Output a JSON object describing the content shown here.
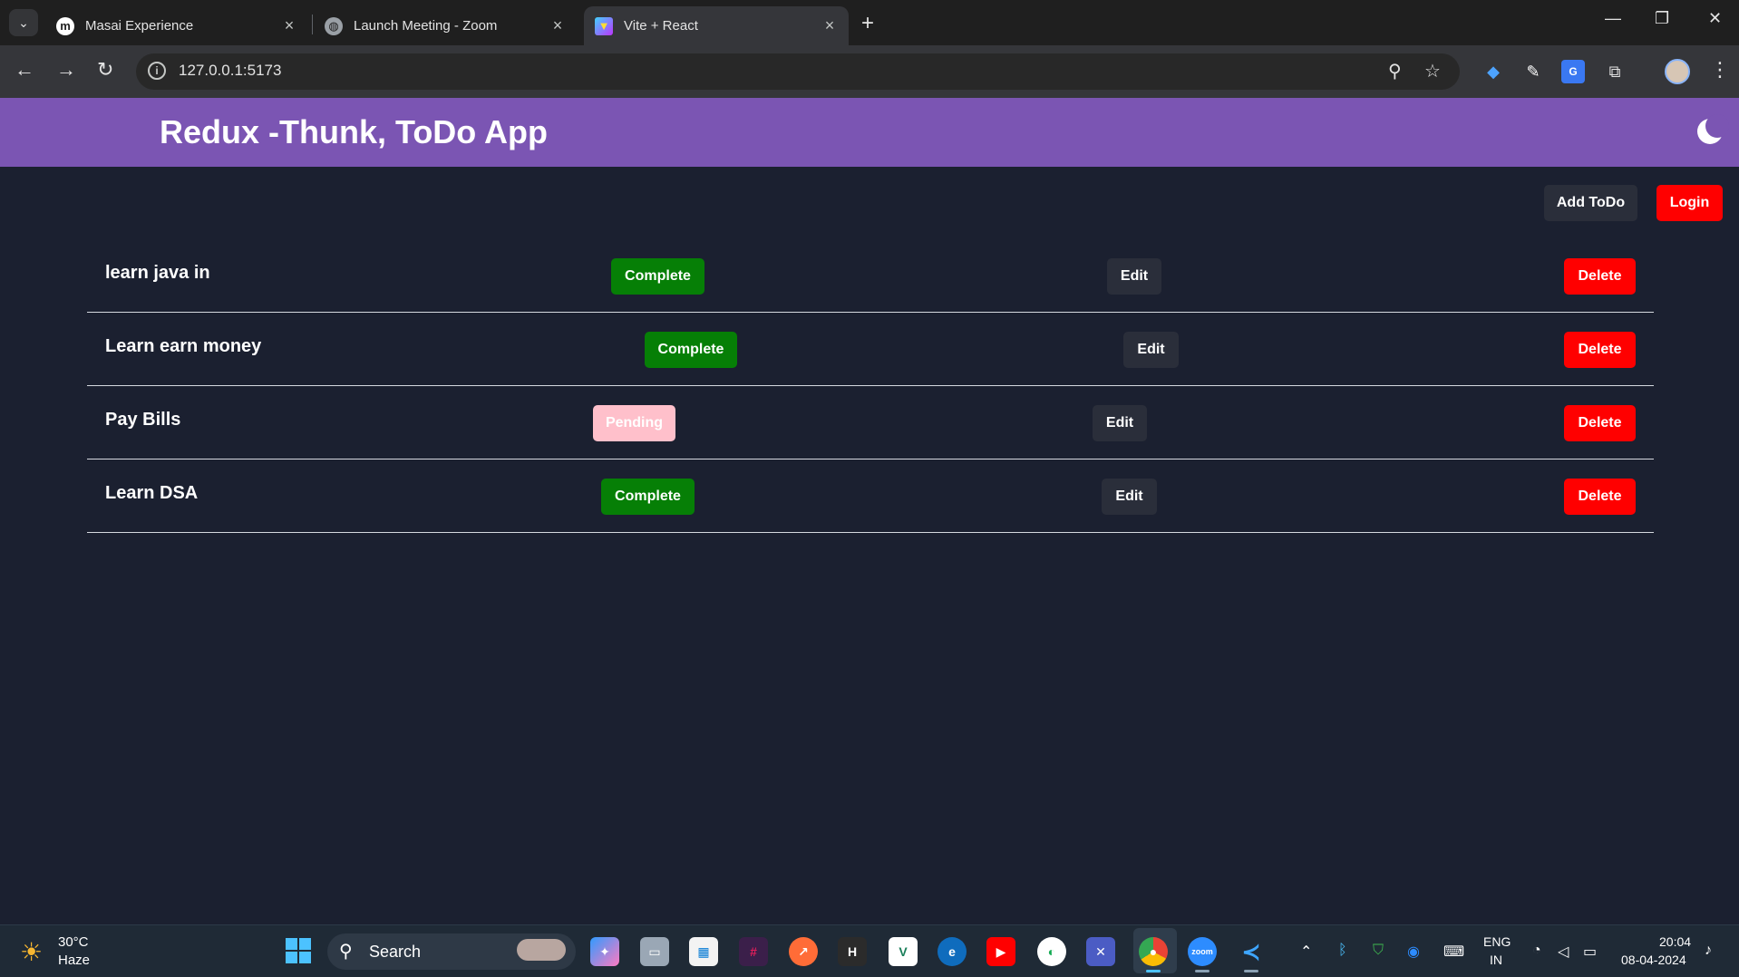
{
  "browser": {
    "tabs": [
      {
        "title": "Masai Experience",
        "favicon": "masai-logo"
      },
      {
        "title": "Launch Meeting - Zoom",
        "favicon": "globe-icon"
      },
      {
        "title": "Vite + React",
        "favicon": "vite-logo"
      }
    ],
    "url": "127.0.0.1:5173"
  },
  "app": {
    "title": "Redux -Thunk, ToDo App",
    "add_todo_label": "Add ToDo",
    "login_label": "Login",
    "colors": {
      "header": "#7b55b3",
      "background": "#1b2030",
      "complete": "#067f06",
      "pending": "#ffc0cb",
      "delete": "#ff0000"
    }
  },
  "todos": [
    {
      "title": "learn java in",
      "status": "Complete",
      "edit_label": "Edit",
      "delete_label": "Delete"
    },
    {
      "title": "Learn earn money",
      "status": "Complete",
      "edit_label": "Edit",
      "delete_label": "Delete"
    },
    {
      "title": "Pay Bills",
      "status": "Pending",
      "edit_label": "Edit",
      "delete_label": "Delete"
    },
    {
      "title": "Learn DSA",
      "status": "Complete",
      "edit_label": "Edit",
      "delete_label": "Delete"
    }
  ],
  "taskbar": {
    "weather_temp": "30°C",
    "weather_desc": "Haze",
    "search_label": "Search",
    "lang_line1": "ENG",
    "lang_line2": "IN",
    "time": "20:04",
    "date": "08-04-2024"
  }
}
